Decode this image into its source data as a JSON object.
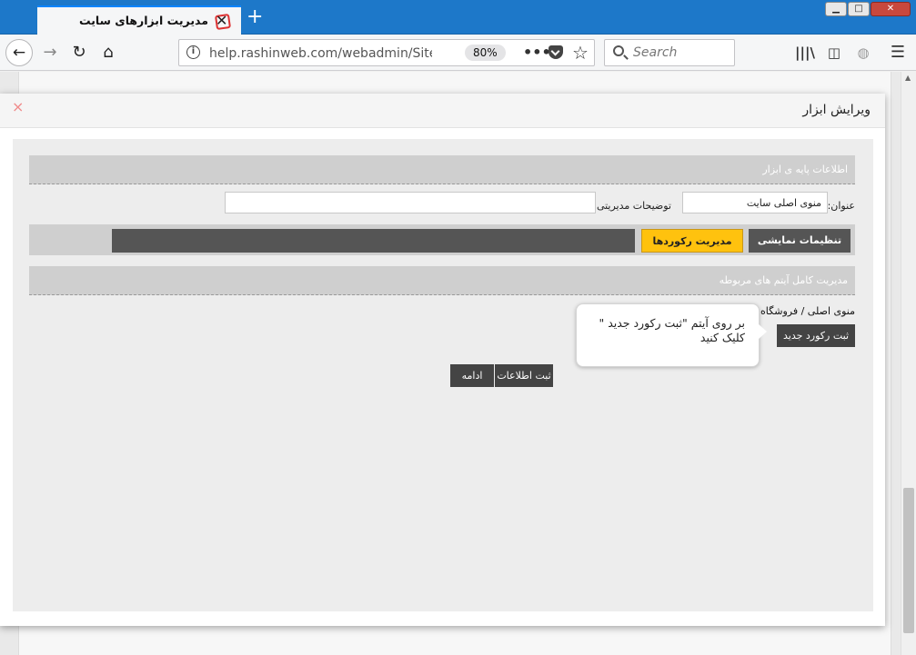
{
  "browser": {
    "tab_title": "مدیریت ابزارهای سایت",
    "url": "help.rashinweb.com/webadmin/Site_gadg",
    "zoom": "80%",
    "search_placeholder": "Search",
    "icons": {
      "back": "back-arrow-icon",
      "forward": "forward-arrow-icon",
      "reload": "reload-icon",
      "home": "home-icon",
      "info": "info-icon",
      "pocket": "pocket-icon",
      "bookmark": "star-icon",
      "library": "library-icon",
      "sidebar": "sidebar-icon",
      "globe": "globe-icon",
      "menu": "hamburger-menu-icon"
    }
  },
  "modal": {
    "title": "ویرایش ابزار",
    "close_glyph": "×",
    "sections": {
      "basic_info": "اطلاعات پایه ی ابزار",
      "items_management": "مدیریت کامل آیتم های مربوطه"
    },
    "fields": {
      "title_label": "عنوان:",
      "title_value": "منوی اصلی سایت",
      "admin_desc_label": "توضیحات مدیریتی:",
      "admin_desc_value": ""
    },
    "tabs": {
      "display_settings": "تنظیمات نمایشی",
      "records_management": "مدیریت رکوردها"
    },
    "breadcrumb": "منوی اصلی / فروشگاه",
    "buttons": {
      "new_record": "ثبت رکورد جدید",
      "save": "ثبت اطلاعات",
      "continue": "ادامه"
    },
    "tooltip": "بر روی آیتم \"ثبت رکورد جدید \" کلیک کنید"
  },
  "colors": {
    "titlebar": "#1d78c9",
    "active_tab": "#ffc20e",
    "dark_button": "#444444",
    "section_bar": "#cfcfcf"
  }
}
